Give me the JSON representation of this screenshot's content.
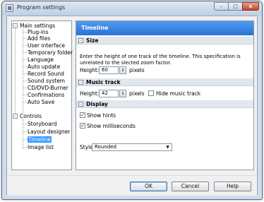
{
  "window": {
    "title": "Program settings"
  },
  "title_buttons": {
    "minimize": "–",
    "maximize": "□",
    "close": "x"
  },
  "tree": {
    "groups": [
      {
        "label": "Main settings",
        "expander": "-",
        "items": [
          "Plug-ins",
          "Add files",
          "User interface",
          "Temporary folder",
          "Language",
          "Auto update",
          "Record Sound",
          "Sound system",
          "CD/DVD-Burner",
          "Confirmations",
          "Auto Save"
        ]
      },
      {
        "label": "Controls",
        "expander": "-",
        "items": [
          "Storyboard",
          "Layout designer",
          "Timeline",
          "Image list"
        ]
      }
    ],
    "selected": "Timeline"
  },
  "panel": {
    "header": "Timeline",
    "size": {
      "heading": "Size",
      "toggle": "-",
      "description": "Enter the height of one track of the timeline. This specification is unrelated to the slected zoom factor.",
      "height_label": "Height:",
      "height_value": "60",
      "unit": "pixels"
    },
    "music_track": {
      "heading": "Music track",
      "toggle": "-",
      "height_label": "Height:",
      "height_value": "42",
      "unit": "pixels",
      "hide_label": "Hide music track",
      "hide_checked": false
    },
    "display": {
      "heading": "Display",
      "toggle": "-",
      "show_hints_label": "Show hints",
      "show_hints_checked": true,
      "show_ms_label": "Show milliseconds",
      "show_ms_checked": true,
      "style_label": "Style:",
      "style_value": "Rounded"
    }
  },
  "buttons": {
    "ok": "OK",
    "cancel": "Cancel",
    "help": "Help"
  },
  "glyphs": {
    "check": "✓",
    "spin": "⇕",
    "dropdown": "▼",
    "grip": "⋰"
  }
}
